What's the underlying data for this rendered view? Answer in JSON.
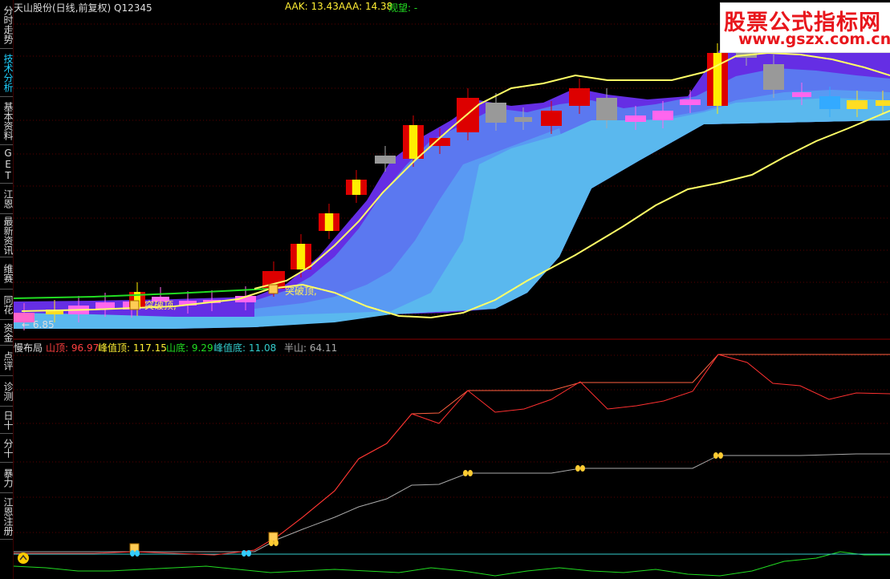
{
  "sidebar": {
    "items": [
      {
        "label": "分时走势",
        "active": false
      },
      {
        "label": "技术分析",
        "active": true
      },
      {
        "label": "基本资料",
        "active": false
      },
      {
        "label": "GET",
        "active": false
      },
      {
        "label": "江恩",
        "active": false
      },
      {
        "label": "最新资讯",
        "active": false
      },
      {
        "label": "维赛",
        "active": false
      },
      {
        "label": "同花",
        "active": false
      },
      {
        "label": "资金",
        "active": false
      },
      {
        "label": "点评",
        "active": false
      },
      {
        "label": "诊测",
        "active": false
      },
      {
        "label": "日十",
        "active": false
      },
      {
        "label": "分十",
        "active": false
      },
      {
        "label": "暴力",
        "active": false
      },
      {
        "label": "江恩注册",
        "active": false
      }
    ]
  },
  "top_header": {
    "title": "天山股份(日线,前复权) Q12345",
    "aak": "AAK: 13.43",
    "aaa": "AAA: 14.38",
    "watch": "观望: -"
  },
  "watermark": {
    "line1": "股票公式指标网",
    "line2": "www.gszx.com.cn"
  },
  "bottom_header": {
    "name": "慢布局",
    "shanding": "山顶: 96.97",
    "fengzhiding": "峰值顶: 117.15",
    "shandi": "山底: 9.29",
    "fengzhidi": "峰值底: 11.08",
    "banshan": "半山: 64.11"
  },
  "annotations": {
    "breakout1": "突破顶,",
    "breakout2": "突破顶,",
    "low_price": "← 6.85"
  },
  "colors": {
    "up": "#e01010",
    "down": "#909090",
    "yellow_line": "#ffff66",
    "green_line": "#22dd22",
    "red_line": "#ff3030",
    "gray_line": "#aaaaaa",
    "cyan_line": "#33cccc",
    "band_light": "#5ab8ee",
    "band_mid": "#5b7cf0",
    "band_dark": "#6a30f0",
    "active_tab": "#1fd0ff"
  }
}
